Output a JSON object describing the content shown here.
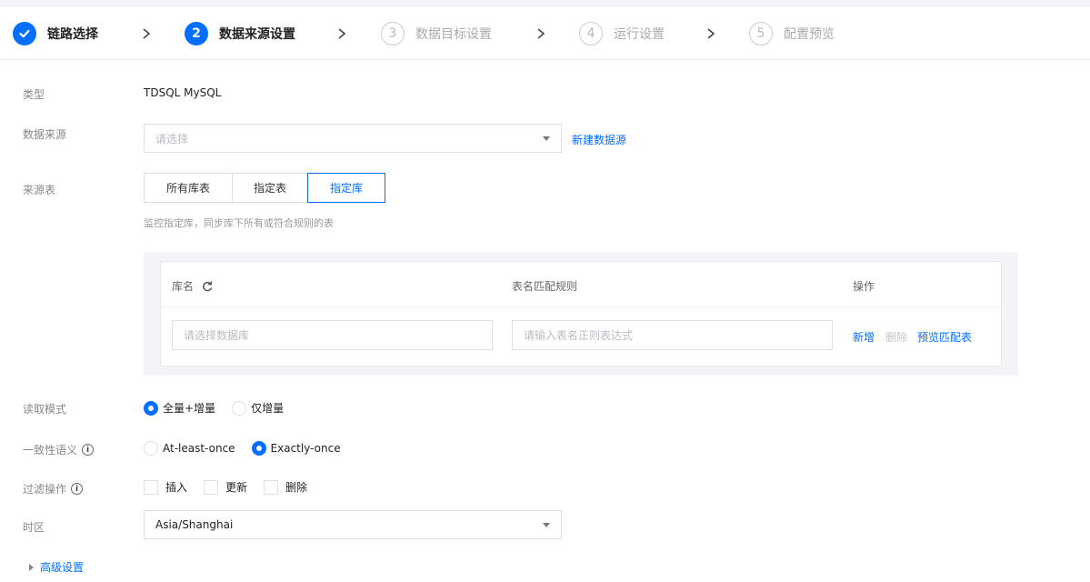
{
  "steps": [
    {
      "num": "",
      "label": "链路选择",
      "state": "done"
    },
    {
      "num": "2",
      "label": "数据来源设置",
      "state": "active"
    },
    {
      "num": "3",
      "label": "数据目标设置",
      "state": "pending"
    },
    {
      "num": "4",
      "label": "运行设置",
      "state": "pending"
    },
    {
      "num": "5",
      "label": "配置预览",
      "state": "pending"
    }
  ],
  "form": {
    "type": {
      "label": "类型",
      "value": "TDSQL MySQL"
    },
    "source": {
      "label": "数据来源",
      "placeholder": "请选择",
      "new_link": "新建数据源"
    },
    "source_table": {
      "label": "来源表",
      "options": [
        "所有库表",
        "指定表",
        "指定库"
      ],
      "selected": "指定库",
      "help": "监控指定库，同步库下所有或符合规则的表"
    },
    "table": {
      "headers": {
        "db": "库名",
        "rule": "表名匹配规则",
        "ops": "操作"
      },
      "db_placeholder": "请选择数据库",
      "rule_placeholder": "请输入表名正则表达式",
      "ops": {
        "add": "新增",
        "delete": "删除",
        "preview": "预览匹配表"
      }
    },
    "read_mode": {
      "label": "读取模式",
      "options": [
        "全量+增量",
        "仅增量"
      ],
      "selected": "全量+增量"
    },
    "consistency": {
      "label": "一致性语义",
      "options": [
        "At-least-once",
        "Exactly-once"
      ],
      "selected": "Exactly-once"
    },
    "filter": {
      "label": "过滤操作",
      "options": [
        "插入",
        "更新",
        "删除"
      ]
    },
    "timezone": {
      "label": "时区",
      "value": "Asia/Shanghai"
    },
    "advanced": "高级设置"
  },
  "colors": {
    "accent": "#006eff"
  },
  "icons": {
    "done": "check-icon",
    "chevron": "chevron-right-icon",
    "refresh": "refresh-icon",
    "info": "info-icon",
    "caret": "caret-down-icon"
  }
}
